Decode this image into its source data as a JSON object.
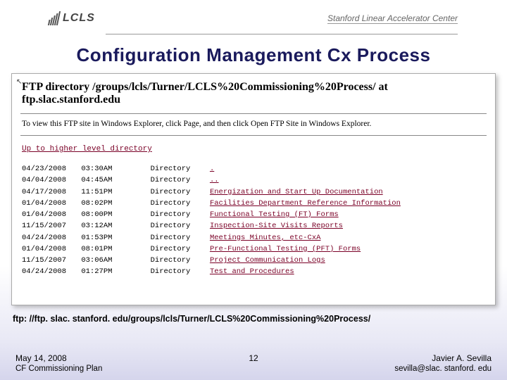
{
  "header": {
    "logo_text": "LCLS",
    "org": "Stanford Linear Accelerator Center"
  },
  "slide_title": "Configuration Management Cx Process",
  "browser": {
    "title": "FTP directory /groups/lcls/Turner/LCLS%20Commissioning%20Process/ at ftp.slac.stanford.edu",
    "instruction": "To view this FTP site in Windows Explorer, click Page, and then click Open FTP Site in Windows Explorer.",
    "uplink": "Up to higher level directory",
    "rows": [
      {
        "date": "04/23/2008",
        "time": "03:30AM",
        "type": "Directory",
        "name": "."
      },
      {
        "date": "04/04/2008",
        "time": "04:45AM",
        "type": "Directory",
        "name": ".."
      },
      {
        "date": "04/17/2008",
        "time": "11:51PM",
        "type": "Directory",
        "name": "Energization and Start Up Documentation"
      },
      {
        "date": "01/04/2008",
        "time": "08:02PM",
        "type": "Directory",
        "name": "Facilities Department Reference Information"
      },
      {
        "date": "01/04/2008",
        "time": "08:00PM",
        "type": "Directory",
        "name": "Functional Testing (FT) Forms"
      },
      {
        "date": "11/15/2007",
        "time": "03:12AM",
        "type": "Directory",
        "name": "Inspection-Site Visits Reports"
      },
      {
        "date": "04/24/2008",
        "time": "01:53PM",
        "type": "Directory",
        "name": "Meetings Minutes, etc-CxA"
      },
      {
        "date": "01/04/2008",
        "time": "08:01PM",
        "type": "Directory",
        "name": "Pre-Functional Testing (PFT) Forms"
      },
      {
        "date": "11/15/2007",
        "time": "03:06AM",
        "type": "Directory",
        "name": "Project Communication Logs"
      },
      {
        "date": "04/24/2008",
        "time": "01:27PM",
        "type": "Directory",
        "name": "Test and Procedures"
      }
    ]
  },
  "ftp_url": "ftp: //ftp. slac. stanford. edu/groups/lcls/Turner/LCLS%20Commissioning%20Process/",
  "footer": {
    "date": "May 14, 2008",
    "plan": "CF Commissioning Plan",
    "page": "12",
    "author": "Javier A. Sevilla",
    "email": "sevilla@slac. stanford. edu"
  }
}
